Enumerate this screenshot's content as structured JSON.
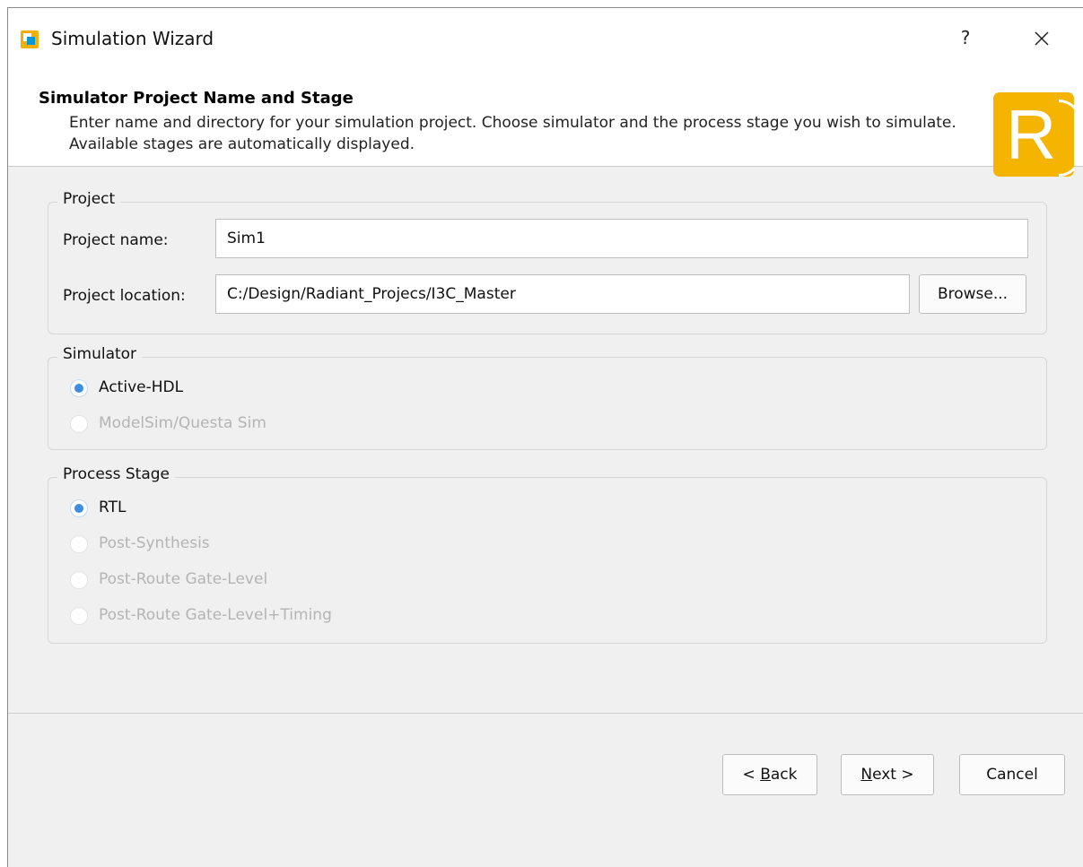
{
  "window": {
    "title": "Simulation Wizard",
    "help_glyph": "?",
    "close_glyph": "✕"
  },
  "header": {
    "title": "Simulator Project Name and Stage",
    "description": "Enter name and directory for your simulation project. Choose simulator and the process stage you wish to simulate. Available stages are automatically displayed.",
    "logo_letter": "R"
  },
  "project": {
    "legend": "Project",
    "name_label": "Project name:",
    "name_value": "Sim1",
    "location_label": "Project location:",
    "location_value": "C:/Design/Radiant_Projecs/I3C_Master",
    "browse_label": "Browse..."
  },
  "simulator": {
    "legend": "Simulator",
    "options": [
      {
        "label": "Active-HDL",
        "checked": true,
        "enabled": true
      },
      {
        "label": "ModelSim/Questa Sim",
        "checked": false,
        "enabled": false
      }
    ]
  },
  "process_stage": {
    "legend": "Process Stage",
    "options": [
      {
        "label": "RTL",
        "checked": true,
        "enabled": true
      },
      {
        "label": "Post-Synthesis",
        "checked": false,
        "enabled": false
      },
      {
        "label": "Post-Route Gate-Level",
        "checked": false,
        "enabled": false
      },
      {
        "label": "Post-Route Gate-Level+Timing",
        "checked": false,
        "enabled": false
      }
    ]
  },
  "footer": {
    "back_prefix": "< ",
    "back_key": "B",
    "back_rest": "ack",
    "next_key": "N",
    "next_rest": "ext >",
    "cancel_label": "Cancel"
  },
  "colors": {
    "accent": "#3d8ee2",
    "logo": "#f4b400",
    "dialog_bg": "#f0f0f0"
  },
  "icons": {
    "app": "radiant-app-icon",
    "logo": "radiant-logo",
    "close": "close-icon",
    "help": "help-icon"
  }
}
